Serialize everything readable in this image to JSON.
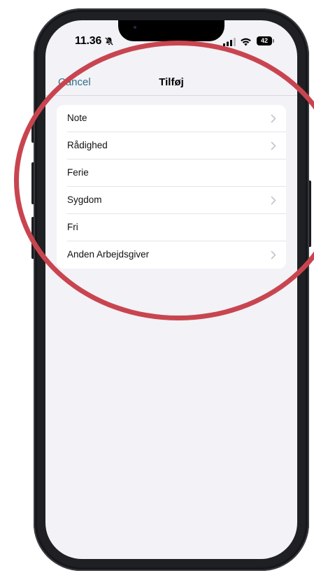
{
  "status_bar": {
    "time": "11.36",
    "battery_level": "42",
    "icons": [
      "bell-slash-icon",
      "cellular-signal-icon",
      "wifi-icon",
      "battery-icon"
    ]
  },
  "nav": {
    "cancel_label": "Cancel",
    "title": "Tilføj"
  },
  "list": {
    "items": [
      {
        "label": "Note",
        "chevron": true
      },
      {
        "label": "Rådighed",
        "chevron": true
      },
      {
        "label": "Ferie",
        "chevron": false
      },
      {
        "label": "Sygdom",
        "chevron": true
      },
      {
        "label": "Fri",
        "chevron": false
      },
      {
        "label": "Anden Arbejdsgiver",
        "chevron": true
      }
    ]
  },
  "colors": {
    "accent": "#2f6f86",
    "annotation_circle": "#c8454f",
    "background": "#f2f2f7",
    "card": "#ffffff",
    "phone_frame": "#1f2024"
  }
}
